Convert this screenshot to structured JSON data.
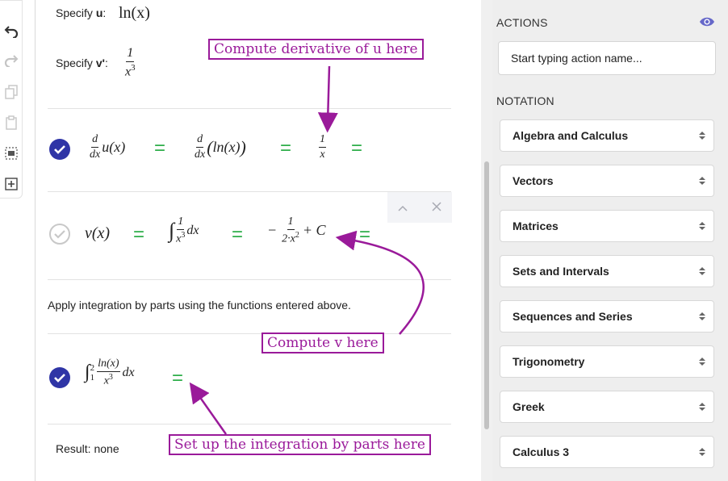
{
  "toolbar": {
    "icons": [
      "undo-icon",
      "redo-icon",
      "copy-icon",
      "paste-icon",
      "select-cell-icon",
      "insert-cell-icon"
    ]
  },
  "worksheet": {
    "specify_u_label": "Specify ",
    "specify_u_var": "u",
    "u_expr": "ln(x)",
    "specify_v_label": "Specify ",
    "specify_v_var": "v'",
    "v_prime_num": "1",
    "v_prime_den_base": "x",
    "v_prime_den_exp": "3",
    "row1": {
      "lhs_d": "d",
      "lhs_dx": "dx",
      "lhs_func": "u(x)",
      "mid_inner": "ln(x)",
      "rhs_num": "1",
      "rhs_den": "x",
      "equals": "="
    },
    "row2": {
      "lhs": "v(x)",
      "integrand_num": "1",
      "integrand_den_base": "x",
      "integrand_den_exp": "3",
      "integrand_dx": "dx",
      "rhs_minus": "−",
      "rhs_num": "1",
      "rhs_den_coef": "2·",
      "rhs_den_base": "x",
      "rhs_den_exp": "2",
      "rhs_const": "+ C",
      "equals": "="
    },
    "apply_text": "Apply integration by parts using the functions entered above.",
    "row3": {
      "upper": "2",
      "lower": "1",
      "num": "ln(x)",
      "den_base": "x",
      "den_exp": "3",
      "dx": "dx",
      "equals": "="
    },
    "result_text": "Result: none"
  },
  "actions": {
    "heading": "ACTIONS",
    "search_placeholder": "Start typing action name..."
  },
  "notation": {
    "heading": "NOTATION",
    "items": [
      "Algebra and Calculus",
      "Vectors",
      "Matrices",
      "Sets and Intervals",
      "Sequences and Series",
      "Trigonometry",
      "Greek",
      "Calculus 3"
    ]
  },
  "annotations": {
    "derivative": "Compute derivative of u here",
    "v": "Compute v here",
    "integration": "Set up the integration by parts here"
  },
  "colors": {
    "equals_green": "#2eae4a",
    "check_blue": "#2f35a6",
    "annotation_purple": "#9a1a9a",
    "panel_bg": "#eeeeee"
  }
}
